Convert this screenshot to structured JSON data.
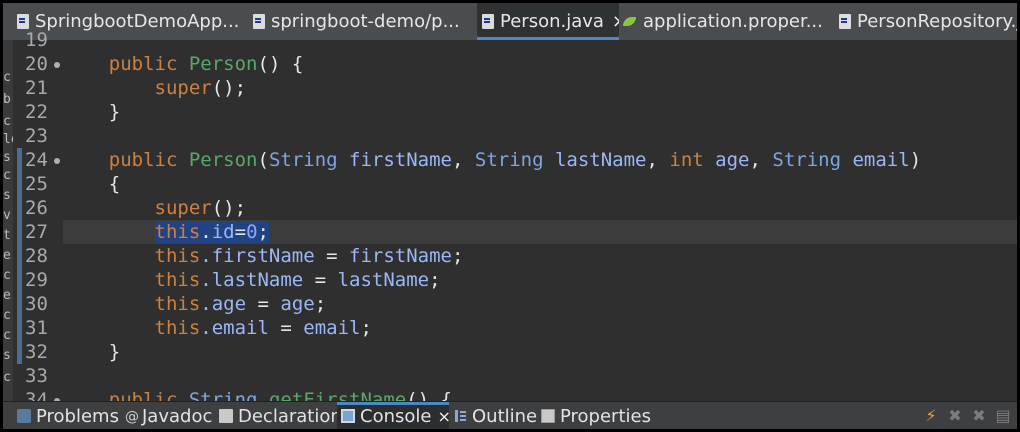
{
  "tabs": [
    {
      "label": "SpringbootDemoApp...",
      "icon": "java-file-icon"
    },
    {
      "label": "springboot-demo/p...",
      "icon": "xml-file-icon"
    },
    {
      "label": "Person.java",
      "icon": "java-file-icon",
      "active": true,
      "close": "×"
    },
    {
      "label": "application.proper...",
      "icon": "spring-leaf-icon"
    },
    {
      "label": "PersonRepository.jav",
      "icon": "java-file-icon"
    }
  ],
  "editor": {
    "line_numbers": [
      "19",
      "20",
      "21",
      "22",
      "23",
      "24",
      "25",
      "26",
      "27",
      "28",
      "29",
      "30",
      "31",
      "32",
      "33",
      "34"
    ],
    "code": {
      "l20_kw": "public",
      "l20_ctor": "Person",
      "l20_rest": "() {",
      "l21_kw": "super",
      "l21_rest": "();",
      "l22": "}",
      "l24_kw": "public",
      "l24_ctor": "Person",
      "l24_p1": "(",
      "l24_t1": "String",
      "l24_v1": "firstName",
      "l24_c1": ", ",
      "l24_t2": "String",
      "l24_v2": "lastName",
      "l24_c2": ", ",
      "l24_t3": "int",
      "l24_v3": "age",
      "l24_c3": ", ",
      "l24_t4": "String",
      "l24_v4": "email",
      "l24_p2": ")",
      "l25": "{",
      "l26_kw": "super",
      "l26_rest": "();",
      "l27_this": "this",
      "l27_dot": ".",
      "l27_id": "id",
      "l27_eq": "=",
      "l27_num": "0",
      "l27_semi": ";",
      "l28_this": "this",
      "l28_field": ".firstName",
      "l28_eq": " = ",
      "l28_val": "firstName",
      "l28_semi": ";",
      "l29_this": "this",
      "l29_field": ".lastName",
      "l29_eq": " = ",
      "l29_val": "lastName",
      "l29_semi": ";",
      "l30_this": "this",
      "l30_field": ".age",
      "l30_eq": " = ",
      "l30_val": "age",
      "l30_semi": ";",
      "l31_this": "this",
      "l31_field": ".email",
      "l31_eq": " = ",
      "l31_val": "email",
      "l31_semi": ";",
      "l32": "}",
      "l34_kw": "public",
      "l34_type": "String",
      "l34_name": "getFirstName",
      "l34_rest": "() {"
    },
    "left_strip_chars": [
      "c",
      "b",
      "c",
      "le",
      "s",
      "c",
      "s",
      "v",
      "t",
      "e",
      "c",
      "e",
      "c",
      "c",
      "s",
      "c"
    ]
  },
  "views": [
    {
      "label": "Problems",
      "icon": "problems-icon"
    },
    {
      "label": "Javadoc",
      "icon": "javadoc-icon",
      "glyph": "@"
    },
    {
      "label": "Declaration",
      "icon": "declaration-icon"
    },
    {
      "label": "Console",
      "icon": "console-icon",
      "active": true,
      "close": "×"
    },
    {
      "label": "Outline",
      "icon": "outline-icon"
    },
    {
      "label": "Properties",
      "icon": "properties-icon"
    }
  ],
  "colors": {
    "keyword": "#cc8142",
    "type": "#7ea6e0",
    "method": "#59a869",
    "variable": "#9bb7f5",
    "selection": "#214283",
    "active_tab_accent": "#4a88c7"
  }
}
